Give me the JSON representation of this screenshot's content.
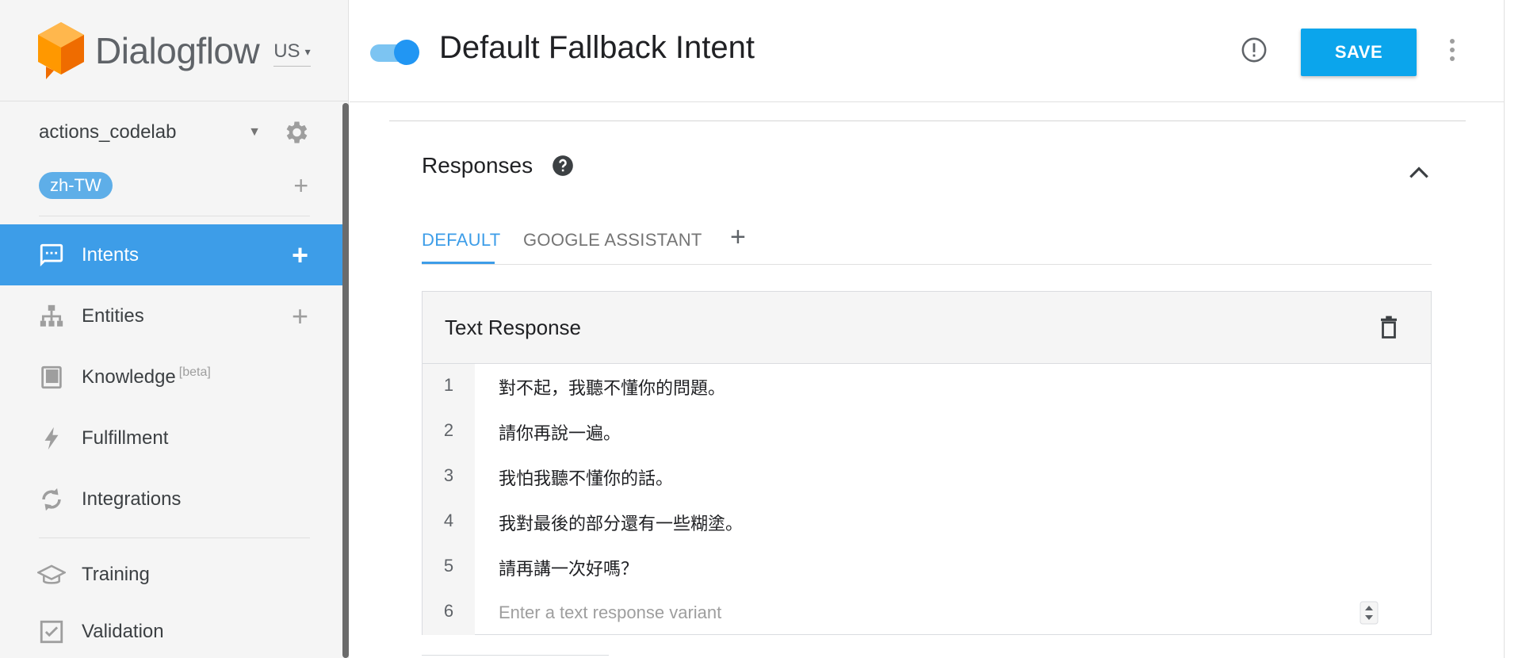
{
  "app": {
    "brand": "Dialogflow",
    "region": "US"
  },
  "sidebar": {
    "agent_name": "actions_codelab",
    "language": "zh-TW",
    "items": [
      {
        "label": "Intents",
        "icon": "chat-icon",
        "active": true,
        "has_add": true
      },
      {
        "label": "Entities",
        "icon": "hierarchy-icon",
        "active": false,
        "has_add": true
      },
      {
        "label": "Knowledge",
        "icon": "book-icon",
        "active": false,
        "badge": "[beta]"
      },
      {
        "label": "Fulfillment",
        "icon": "bolt-icon",
        "active": false
      },
      {
        "label": "Integrations",
        "icon": "sync-icon",
        "active": false
      },
      {
        "label": "Training",
        "icon": "graduation-cap-icon",
        "active": false
      },
      {
        "label": "Validation",
        "icon": "checkbox-icon",
        "active": false
      }
    ]
  },
  "header": {
    "intent_title": "Default Fallback Intent",
    "save_label": "SAVE",
    "intent_enabled": true
  },
  "responses": {
    "title": "Responses",
    "tabs": [
      "DEFAULT",
      "GOOGLE ASSISTANT"
    ],
    "active_tab": "DEFAULT",
    "card_title": "Text Response",
    "rows": [
      {
        "num": "1",
        "text": "對不起，我聽不懂你的問題。"
      },
      {
        "num": "2",
        "text": "請你再說一遍。"
      },
      {
        "num": "3",
        "text": "我怕我聽不懂你的話。"
      },
      {
        "num": "4",
        "text": "我對最後的部分還有一些糊塗。"
      },
      {
        "num": "5",
        "text": "請再講一次好嗎？"
      }
    ],
    "new_row": {
      "num": "6",
      "placeholder": "Enter a text response variant"
    }
  },
  "colors": {
    "accent": "#3d9de8",
    "save": "#0ba5ec",
    "logo_orange": "#ff9800"
  }
}
